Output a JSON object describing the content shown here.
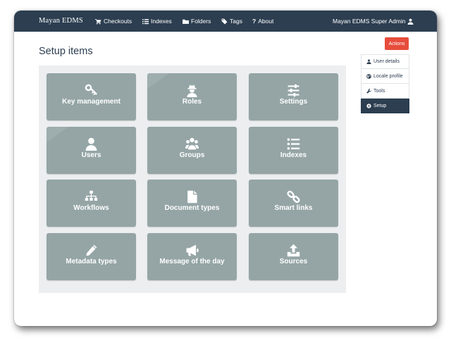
{
  "navbar": {
    "brand": "Mayan EDMS",
    "items": [
      {
        "label": "Checkouts",
        "icon": "cart-icon"
      },
      {
        "label": "Indexes",
        "icon": "list-icon"
      },
      {
        "label": "Folders",
        "icon": "folder-icon"
      },
      {
        "label": "Tags",
        "icon": "tag-icon"
      },
      {
        "label": "About",
        "icon": "question-icon"
      }
    ],
    "user": {
      "label": "Mayan EDMS Super Admin",
      "icon": "user-icon"
    }
  },
  "page": {
    "title": "Setup items"
  },
  "tiles": [
    {
      "label": "Key management",
      "icon": "key-icon"
    },
    {
      "label": "Roles",
      "icon": "user-secret-icon"
    },
    {
      "label": "Settings",
      "icon": "sliders-icon"
    },
    {
      "label": "Users",
      "icon": "user-icon"
    },
    {
      "label": "Groups",
      "icon": "users-icon"
    },
    {
      "label": "Indexes",
      "icon": "list-icon"
    },
    {
      "label": "Workflows",
      "icon": "sitemap-icon"
    },
    {
      "label": "Document types",
      "icon": "file-icon"
    },
    {
      "label": "Smart links",
      "icon": "link-icon"
    },
    {
      "label": "Metadata types",
      "icon": "pencil-icon"
    },
    {
      "label": "Message of the day",
      "icon": "bullhorn-icon"
    },
    {
      "label": "Sources",
      "icon": "upload-icon"
    }
  ],
  "actions": {
    "label": "Actions",
    "color": "#e74c3c"
  },
  "side_menu": {
    "items": [
      {
        "label": "User details",
        "icon": "user-icon",
        "active": false
      },
      {
        "label": "Locale profile",
        "icon": "globe-icon",
        "active": false
      },
      {
        "label": "Tools",
        "icon": "wrench-icon",
        "active": false
      },
      {
        "label": "Setup",
        "icon": "gear-icon",
        "active": true
      }
    ]
  },
  "colors": {
    "navbar": "#2c3e50",
    "tile": "#95a5a6",
    "panel": "#eceeef",
    "accent": "#e74c3c"
  }
}
